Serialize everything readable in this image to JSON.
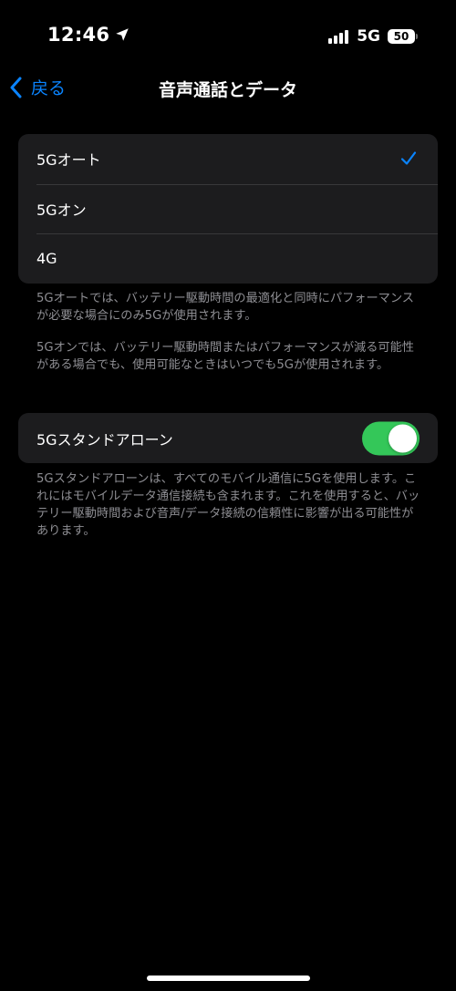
{
  "status_bar": {
    "time": "12:46",
    "network": "5G",
    "battery": "50"
  },
  "nav": {
    "back_label": "戻る",
    "title": "音声通話とデータ"
  },
  "modes": {
    "items": [
      {
        "label": "5Gオート",
        "selected": true
      },
      {
        "label": "5Gオン",
        "selected": false
      },
      {
        "label": "4G",
        "selected": false
      }
    ],
    "note_1": "5Gオートでは、バッテリー駆動時間の最適化と同時にパフォーマンスが必要な場合にのみ5Gが使用されます。",
    "note_2": "5Gオンでは、バッテリー駆動時間またはパフォーマンスが減る可能性がある場合でも、使用可能なときはいつでも5Gが使用されます。"
  },
  "standalone": {
    "label": "5Gスタンドアローン",
    "enabled": true,
    "note": "5Gスタンドアローンは、すべてのモバイル通信に5Gを使用します。これにはモバイルデータ通信接続も含まれます。これを使用すると、バッテリー駆動時間および音声/データ接続の信頼性に影響が出る可能性があります。"
  },
  "colors": {
    "accent": "#0a84ff",
    "toggle_on": "#34c759",
    "cell_background": "#1c1c1e",
    "secondary_text": "#8e8e93"
  },
  "icons": {
    "location": "location-arrow-icon",
    "signal": "cellular-signal-icon",
    "battery": "battery-icon",
    "back": "chevron-left-icon",
    "check": "checkmark-icon"
  }
}
